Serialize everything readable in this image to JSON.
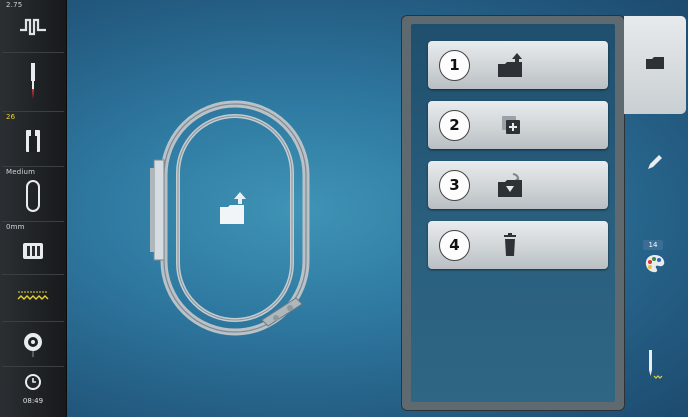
{
  "status_bar": {
    "top_value": "2.75",
    "needle_number": "26",
    "presser_foot_pressure": "Medium",
    "offset": "0mm",
    "clock_time": "08:49",
    "icons": [
      "stitch-length-icon",
      "needle-icon",
      "presser-foot-icon",
      "presser-foot-pressure-icon",
      "feed-dog-icon",
      "stitch-plate-icon",
      "bobbin-icon",
      "clock-icon"
    ]
  },
  "hoop_icon": "folder-upload-icon",
  "menu": {
    "items": [
      {
        "number": "1",
        "icon": "folder-upload-icon"
      },
      {
        "number": "2",
        "icon": "add-copy-icon"
      },
      {
        "number": "3",
        "icon": "folder-save-icon"
      },
      {
        "number": "4",
        "icon": "trash-icon"
      }
    ]
  },
  "right_tabs": {
    "color_count": "14",
    "icons": [
      "folder-icon",
      "pencil-icon",
      "color-palette-icon",
      "needle-stitch-icon"
    ]
  },
  "colors": {
    "accent_yellow": "#e6d236",
    "panel_bg": "#1f4f6d",
    "button_face": "#d6dadd"
  }
}
